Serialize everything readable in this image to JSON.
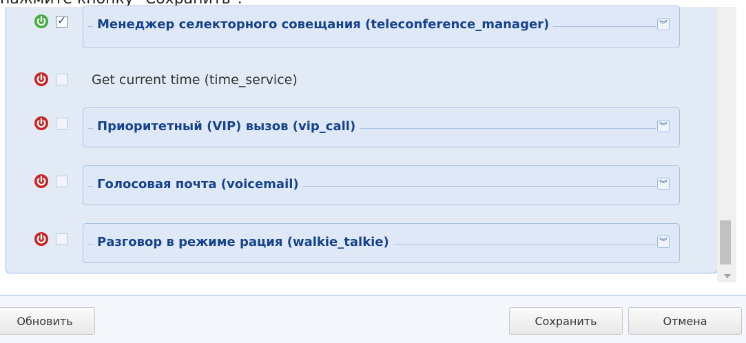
{
  "header_text": "нажмите кнопку \"Сохранить\".",
  "rows": [
    {
      "type": "fieldset",
      "enabled": true,
      "checked": true,
      "label": "Менеджер селекторного совещания (teleconference_manager)"
    },
    {
      "type": "plain",
      "enabled": false,
      "checked": false,
      "label": "Get current time (time_service)"
    },
    {
      "type": "fieldset",
      "enabled": false,
      "checked": false,
      "label": "Приоритетный (VIP) вызов (vip_call)"
    },
    {
      "type": "fieldset",
      "enabled": false,
      "checked": false,
      "label": "Голосовая почта (voicemail)"
    },
    {
      "type": "fieldset",
      "enabled": false,
      "checked": false,
      "label": "Разговор в режиме рация (walkie_talkie)"
    }
  ],
  "icons": {
    "power": "power-icon",
    "expand": "double-chevron-down-icon"
  },
  "colors": {
    "power_on": "#3fae3f",
    "power_off": "#cc2222",
    "legend_text": "#15428b"
  },
  "footer": {
    "refresh_label": "Обновить",
    "save_label": "Сохранить",
    "cancel_label": "Отмена"
  }
}
